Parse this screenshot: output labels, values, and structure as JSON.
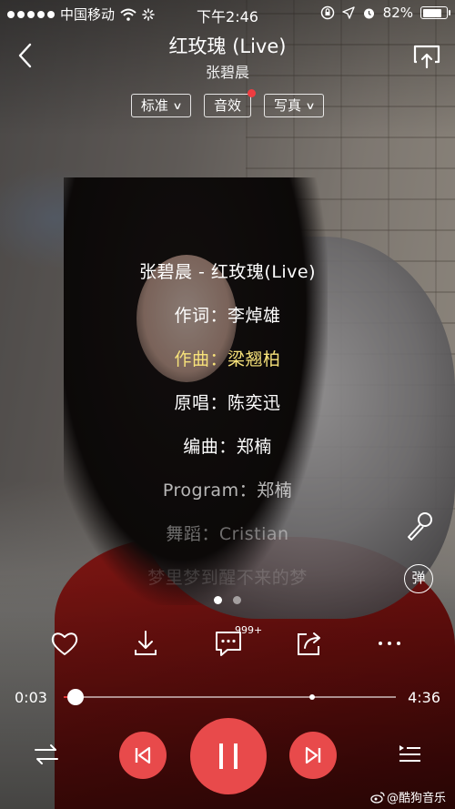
{
  "status_bar": {
    "carrier": "中国移动",
    "time": "下午2:46",
    "battery_percent": "82%",
    "battery_level": 0.82,
    "icons": [
      "signal-dots-icon",
      "wifi-icon",
      "loading-icon",
      "lock-rotation-icon",
      "location-icon",
      "alarm-icon",
      "battery-icon"
    ]
  },
  "header": {
    "title": "红玫瑰 (Live)",
    "artist": "张碧晨"
  },
  "pills": {
    "quality_label": "标准",
    "effect_label": "音效",
    "photo_label": "写真"
  },
  "lyrics": [
    {
      "text": "张碧晨 - 红玫瑰(Live)",
      "color": "#ffffff",
      "opacity": 1
    },
    {
      "text": "作词：李焯雄",
      "color": "#ffffff",
      "opacity": 1
    },
    {
      "text": "作曲：梁翘柏",
      "color": "#f7e27a",
      "opacity": 1
    },
    {
      "text": "原唱：陈奕迅",
      "color": "#ffffff",
      "opacity": 1
    },
    {
      "text": "编曲：郑楠",
      "color": "#ffffff",
      "opacity": 1
    },
    {
      "text": "Program：郑楠",
      "color": "#ffffff",
      "opacity": 0.7
    },
    {
      "text": "舞蹈：Cristian",
      "color": "#ffffff",
      "opacity": 0.4
    },
    {
      "text": "梦里梦到醒不来的梦",
      "color": "#ffffff",
      "opacity": 0.15
    }
  ],
  "side": {
    "danmu_label": "弹"
  },
  "actions": {
    "comment_count": "999+"
  },
  "player": {
    "current_time": "0:03",
    "total_time": "4:36",
    "progress_fraction": 0.011,
    "accent_color": "#e84a4b"
  },
  "watermark": "@酷狗音乐"
}
